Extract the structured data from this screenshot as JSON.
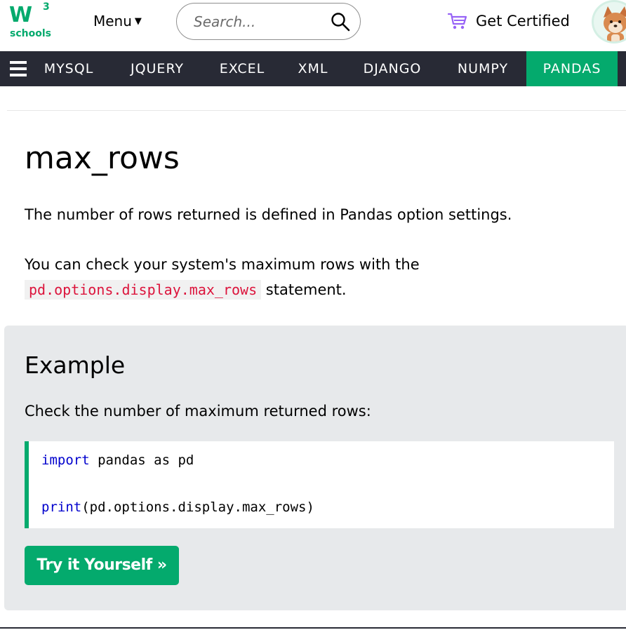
{
  "header": {
    "logo_mark": "W",
    "logo_sup": "3",
    "logo_text": "schools",
    "menu_label": "Menu",
    "search_placeholder": "Search...",
    "cert_label": "Get Certified"
  },
  "nav": {
    "items": [
      {
        "label": "MYSQL",
        "active": false
      },
      {
        "label": "JQUERY",
        "active": false
      },
      {
        "label": "EXCEL",
        "active": false
      },
      {
        "label": "XML",
        "active": false
      },
      {
        "label": "DJANGO",
        "active": false
      },
      {
        "label": "NUMPY",
        "active": false
      },
      {
        "label": "PANDAS",
        "active": true
      }
    ]
  },
  "main": {
    "title": "max_rows",
    "para1": "The number of rows returned is defined in Pandas option settings.",
    "para2_prefix": "You can check your system's maximum rows with the",
    "para2_code": "pd.options.display.max_rows",
    "para2_suffix": "statement."
  },
  "example": {
    "title": "Example",
    "description": "Check the number of maximum returned rows:",
    "code_line1_kw": "import",
    "code_line1_rest": " pandas as pd",
    "code_line2_kw": "print",
    "code_line2_rest": "(pd.options.display.max_rows)",
    "try_button": "Try it Yourself »"
  },
  "colors": {
    "accent": "#04AA6D",
    "navbar": "#282A35",
    "panel": "#E7E9EB",
    "inline_code": "#DC143C",
    "keyword": "#0000CD"
  }
}
